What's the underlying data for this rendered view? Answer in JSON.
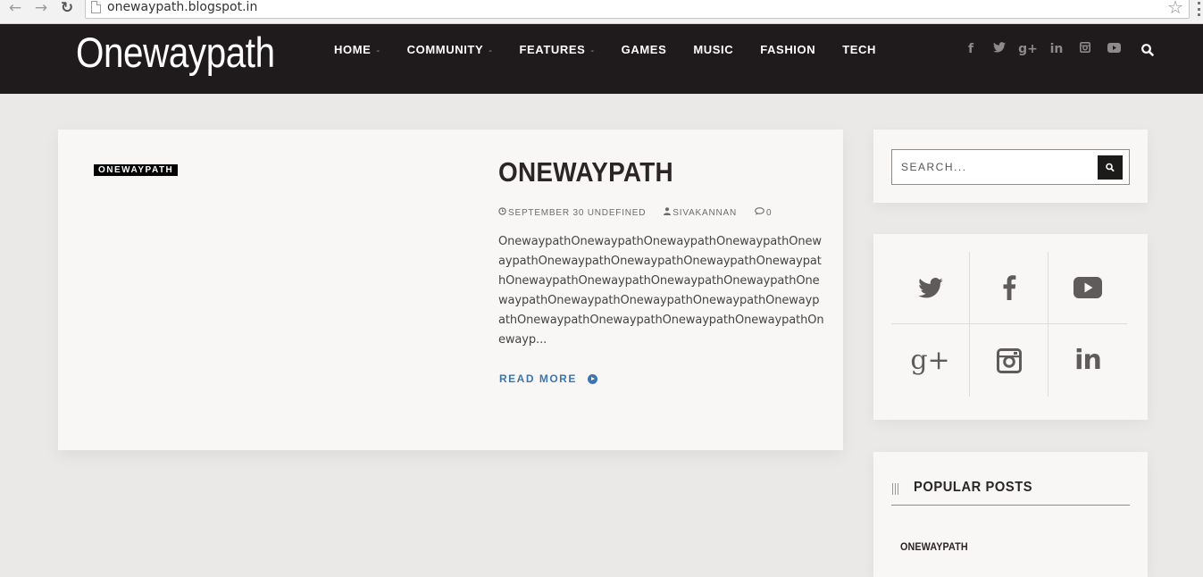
{
  "browser": {
    "url": "onewaypath.blogspot.in",
    "back_icon": "arrow-left-icon",
    "forward_icon": "arrow-right-icon",
    "reload_icon": "reload-icon",
    "bookmark_icon": "star-icon"
  },
  "header": {
    "logo": "Onewaypath",
    "nav": [
      {
        "label": "HOME",
        "dropdown": true
      },
      {
        "label": "COMMUNITY",
        "dropdown": true
      },
      {
        "label": "FEATURES",
        "dropdown": true
      },
      {
        "label": "GAMES",
        "dropdown": false
      },
      {
        "label": "MUSIC",
        "dropdown": false
      },
      {
        "label": "FASHION",
        "dropdown": false
      },
      {
        "label": "TECH",
        "dropdown": false
      }
    ],
    "social_icons": [
      "facebook-icon",
      "twitter-icon",
      "google-plus-icon",
      "linkedin-icon",
      "instagram-icon",
      "youtube-icon"
    ],
    "search_icon": "search-icon"
  },
  "post": {
    "category": "ONEWAYPATH",
    "title": "ONEWAYPATH",
    "date": "SEPTEMBER 30 UNDEFINED",
    "author": "SIVAKANNAN",
    "comments": "0",
    "excerpt": "OnewaypathOnewaypathOnewaypathOnewaypathOnewaypathOnewaypathOnewaypathOnewaypathOnewaypathOnewaypathOnewaypathOnewaypathOnewaypathOnewaypathOnewaypathOnewaypathOnewaypathOnewaypathOnewaypathOnewaypathOnewaypathOnewaypathOnewayp...",
    "read_more": "READ MORE",
    "accent_color": "#3d76ad"
  },
  "sidebar": {
    "search": {
      "placeholder": "SEARCH..."
    },
    "social_grid": [
      "twitter-icon",
      "facebook-icon",
      "youtube-icon",
      "google-plus-icon",
      "instagram-icon",
      "linkedin-icon"
    ],
    "google_plus_glyph": "g+",
    "linkedin_glyph": "in",
    "popular_posts": {
      "title": "POPULAR POSTS",
      "items": [
        "ONEWAYPATH"
      ]
    }
  },
  "colors": {
    "header_bg": "#1f1a1b",
    "page_bg": "#ebe9e7",
    "card_bg": "#f8f7f6"
  }
}
